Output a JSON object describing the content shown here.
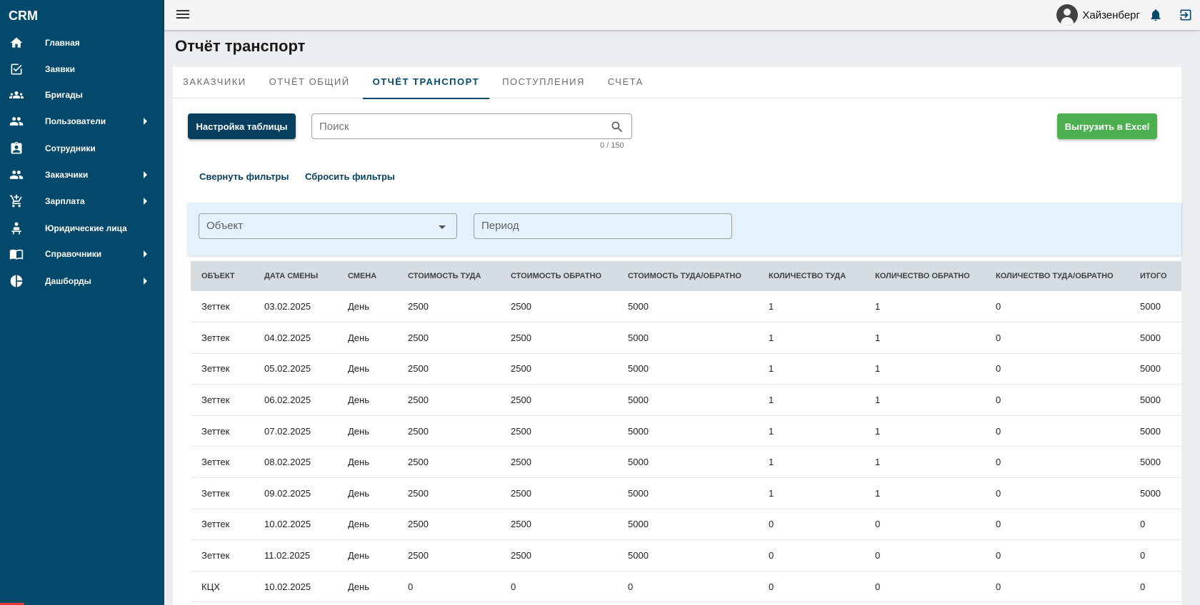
{
  "app": {
    "brand": "CRM"
  },
  "sidebar": {
    "items": [
      {
        "label": "Главная",
        "icon": "home-icon",
        "has_submenu": false
      },
      {
        "label": "Заявки",
        "icon": "checkbox-icon",
        "has_submenu": false
      },
      {
        "label": "Бригады",
        "icon": "groups-icon",
        "has_submenu": false
      },
      {
        "label": "Пользователи",
        "icon": "people-icon",
        "has_submenu": true
      },
      {
        "label": "Сотрудники",
        "icon": "badge-icon",
        "has_submenu": false
      },
      {
        "label": "Заказчики",
        "icon": "people-icon",
        "has_submenu": true
      },
      {
        "label": "Зарплата",
        "icon": "cart-icon",
        "has_submenu": true
      },
      {
        "label": "Юридические лица",
        "icon": "person-desk-icon",
        "has_submenu": false
      },
      {
        "label": "Справочники",
        "icon": "book-icon",
        "has_submenu": true
      },
      {
        "label": "Дашборды",
        "icon": "pie-chart-icon",
        "has_submenu": true
      }
    ]
  },
  "topbar": {
    "username": "Хайзенберг"
  },
  "page": {
    "title": "Отчёт транспорт"
  },
  "tabs": [
    {
      "label": "Заказчики",
      "active": false
    },
    {
      "label": "Отчёт общий",
      "active": false
    },
    {
      "label": "Отчёт транспорт",
      "active": true
    },
    {
      "label": "Поступления",
      "active": false
    },
    {
      "label": "Счета",
      "active": false
    }
  ],
  "toolbar": {
    "settings_label": "Настройка таблицы",
    "search_placeholder": "Поиск",
    "search_value": "",
    "search_counter": "0 / 150",
    "excel_label": "Выгрузить в Excel"
  },
  "filters": {
    "collapse_label": "Свернуть фильтры",
    "reset_label": "Сбросить фильтры",
    "object_placeholder": "Объект",
    "period_placeholder": "Период"
  },
  "table": {
    "columns": [
      "Объект",
      "Дата смены",
      "Смена",
      "Стоимость туда",
      "Стоимость обратно",
      "Стоимость туда/обратно",
      "Количество туда",
      "Количество обратно",
      "Количество туда/обратно",
      "Итого"
    ],
    "rows": [
      [
        "Зеттек",
        "03.02.2025",
        "День",
        "2500",
        "2500",
        "5000",
        "1",
        "1",
        "0",
        "5000"
      ],
      [
        "Зеттек",
        "04.02.2025",
        "День",
        "2500",
        "2500",
        "5000",
        "1",
        "1",
        "0",
        "5000"
      ],
      [
        "Зеттек",
        "05.02.2025",
        "День",
        "2500",
        "2500",
        "5000",
        "1",
        "1",
        "0",
        "5000"
      ],
      [
        "Зеттек",
        "06.02.2025",
        "День",
        "2500",
        "2500",
        "5000",
        "1",
        "1",
        "0",
        "5000"
      ],
      [
        "Зеттек",
        "07.02.2025",
        "День",
        "2500",
        "2500",
        "5000",
        "1",
        "1",
        "0",
        "5000"
      ],
      [
        "Зеттек",
        "08.02.2025",
        "День",
        "2500",
        "2500",
        "5000",
        "1",
        "1",
        "0",
        "5000"
      ],
      [
        "Зеттек",
        "09.02.2025",
        "День",
        "2500",
        "2500",
        "5000",
        "1",
        "1",
        "0",
        "5000"
      ],
      [
        "Зеттек",
        "10.02.2025",
        "День",
        "2500",
        "2500",
        "5000",
        "0",
        "0",
        "0",
        "0"
      ],
      [
        "Зеттек",
        "11.02.2025",
        "День",
        "2500",
        "2500",
        "5000",
        "0",
        "0",
        "0",
        "0"
      ],
      [
        "КЦХ",
        "10.02.2025",
        "День",
        "0",
        "0",
        "0",
        "0",
        "0",
        "0",
        "0"
      ]
    ]
  },
  "colors": {
    "sidebar": "#03496b",
    "primary": "#063f5f",
    "excel": "#4caf50",
    "filter_bg": "#e3f2fd"
  }
}
